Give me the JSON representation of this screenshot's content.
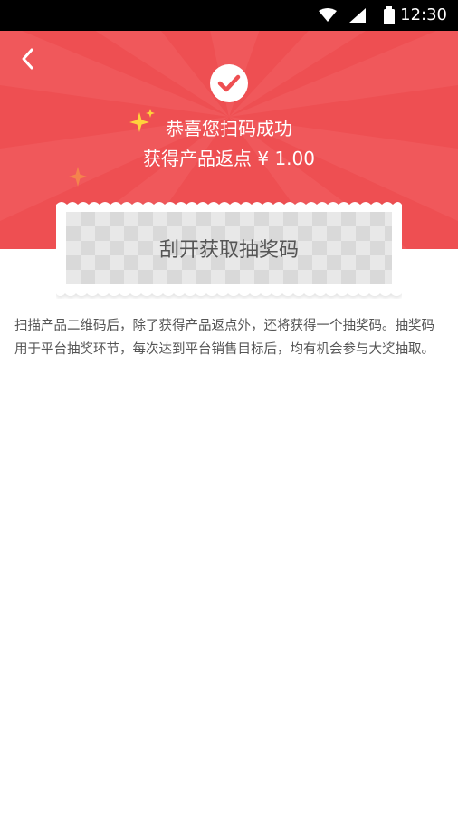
{
  "status_bar": {
    "time": "12:30"
  },
  "header": {
    "title": "恭喜您扫码成功",
    "rebate_label": "获得产品返点",
    "rebate_amount": "¥ 1.00"
  },
  "scratch_card": {
    "label": "刮开获取抽奖码"
  },
  "description": "扫描产品二维码后，除了获得产品返点外，还将获得一个抽奖码。抽奖码用于平台抽奖环节，每次达到平台销售目标后，均有机会参与大奖抽取。",
  "colors": {
    "primary": "#ee4f52",
    "accent_yellow": "#ffd23c",
    "accent_orange": "#f5834d"
  },
  "icons": [
    "back-icon",
    "check-circle-icon",
    "sparkle-icon",
    "wifi-icon",
    "signal-icon",
    "battery-icon"
  ]
}
